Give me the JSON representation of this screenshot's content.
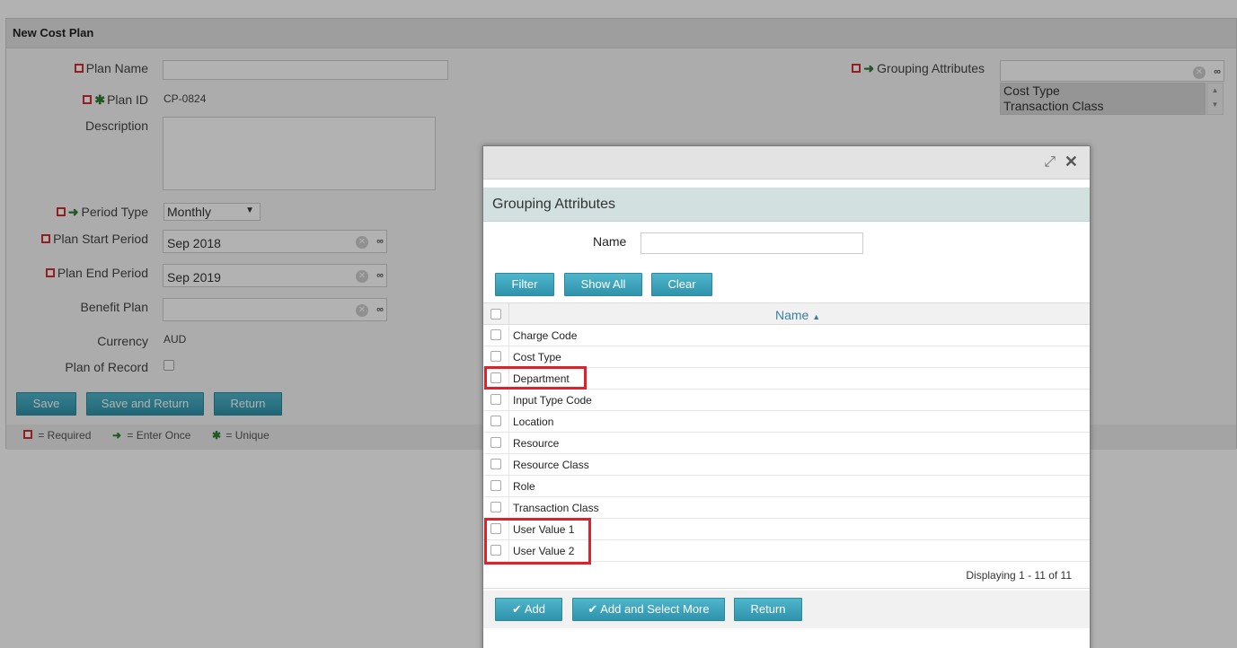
{
  "form": {
    "title": "New Cost Plan",
    "plan_name_label": "Plan Name",
    "plan_id_label": "Plan ID",
    "plan_id_value": "CP-0824",
    "description_label": "Description",
    "period_type_label": "Period Type",
    "period_type_value": "Monthly",
    "plan_start_label": "Plan Start Period",
    "plan_start_value": "Sep 2018",
    "plan_end_label": "Plan End Period",
    "plan_end_value": "Sep 2019",
    "benefit_plan_label": "Benefit Plan",
    "currency_label": "Currency",
    "currency_value": "AUD",
    "plan_of_record_label": "Plan of Record",
    "grouping_attributes_label": "Grouping Attributes",
    "grouping_selected": [
      "Cost Type",
      "Transaction Class"
    ],
    "buttons": {
      "save": "Save",
      "save_return": "Save and Return",
      "return": "Return"
    },
    "legend": {
      "required": "= Required",
      "enter_once": "= Enter Once",
      "unique": "= Unique"
    }
  },
  "modal": {
    "title": "Grouping Attributes",
    "name_label": "Name",
    "name_value": "",
    "buttons": {
      "filter": "Filter",
      "show_all": "Show All",
      "clear": "Clear"
    },
    "column_header": "Name",
    "sort_indicator": "▲",
    "rows": [
      "Charge Code",
      "Cost Type",
      "Department",
      "Input Type Code",
      "Location",
      "Resource",
      "Resource Class",
      "Role",
      "Transaction Class",
      "User Value 1",
      "User Value 2"
    ],
    "displaying": "Displaying 1 - 11 of 11",
    "footer_buttons": {
      "add": "Add",
      "add_select_more": "Add and Select More",
      "return": "Return"
    }
  },
  "icons": {
    "required": "required-marker-icon",
    "enter_once": "arrow-right-icon",
    "unique": "asterisk-icon",
    "clear": "clear-icon",
    "lookup": "binoculars-icon",
    "expand": "expand-icon",
    "close": "close-icon",
    "check": "check-icon"
  },
  "colors": {
    "highlight": "#e0202a",
    "button": "#3aa0b8",
    "modal_title_bar": "#d2e0e0"
  }
}
